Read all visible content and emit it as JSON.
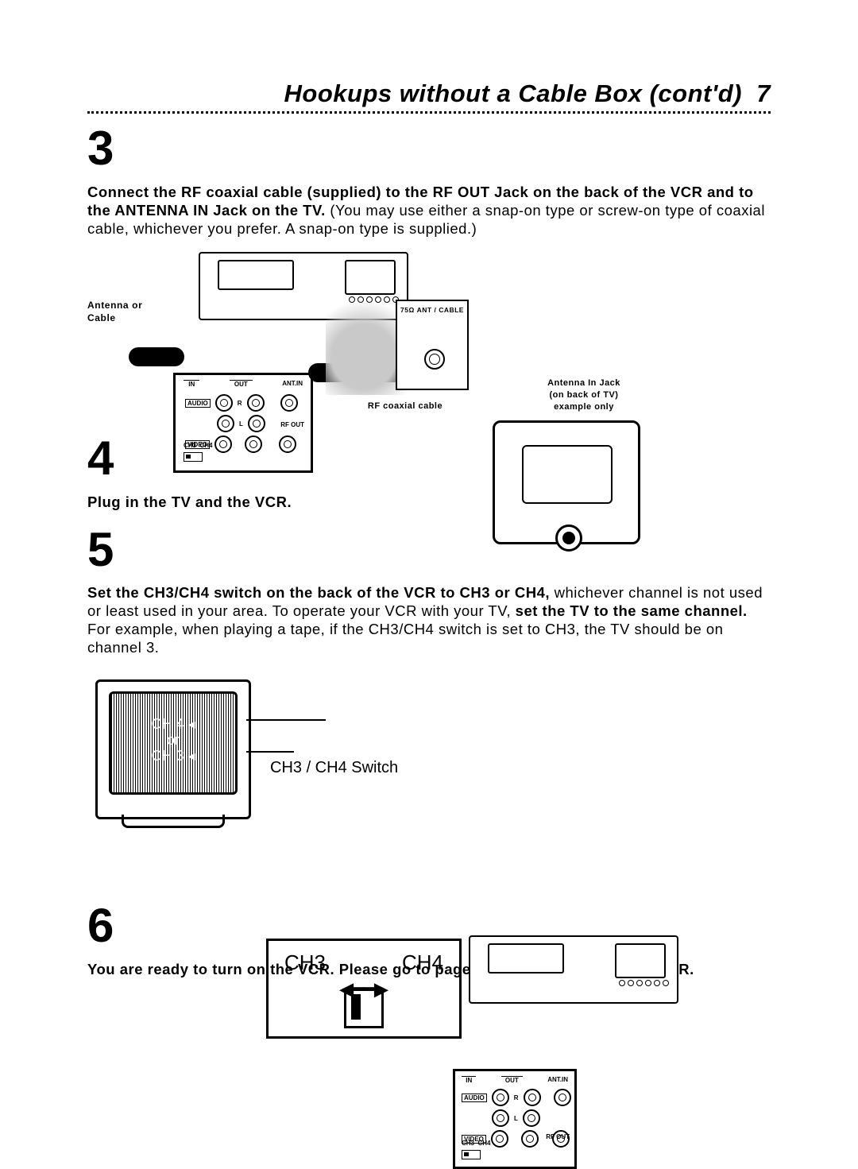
{
  "header": {
    "title": "Hookups without a Cable Box (cont'd)",
    "page": "7"
  },
  "step3": {
    "num": "3",
    "bold_a": "Connect the RF coaxial cable (supplied) to the RF OUT Jack on the back of the VCR and to the ANTENNA IN Jack on the TV.",
    "rest": " (You may use either a snap-on type or screw-on type of coaxial cable, whichever you prefer. A snap-on type is supplied.)"
  },
  "fig1": {
    "antenna_or_cable": "Antenna or Cable",
    "in": "IN",
    "out": "OUT",
    "ant_in": "ANT.IN",
    "audio": "AUDIO",
    "video": "VIDEO",
    "L": "L",
    "R": "R",
    "rf_out": "RF OUT",
    "ch3": "CH3",
    "ch4": "CH4",
    "port_label": "75Ω ANT / CABLE",
    "rf_cable": "RF coaxial cable",
    "ant_in_jack": "Antenna In Jack",
    "on_back": "(on back of TV)",
    "example": "example only"
  },
  "step4": {
    "num": "4",
    "bold": "Plug in the TV and the VCR."
  },
  "step5": {
    "num": "5",
    "bold_a": "Set the CH3/CH4 switch on the back of the VCR to CH3 or CH4,",
    "mid": " whichever channel is not used or least used in your area. To operate your VCR with your TV, ",
    "bold_b": "set the TV to the same channel.",
    "rest": " For example, when playing a tape, if the CH3/CH4 switch is set to CH3, the TV should be on channel 3."
  },
  "fig2": {
    "tv_ch4": "CH 4",
    "tv_or": "or",
    "tv_ch3": "CH 3",
    "switch_title": "CH3 / CH4 Switch",
    "CH3": "CH3",
    "CH4": "CH4",
    "in": "IN",
    "out": "OUT",
    "ant_in": "ANT.IN",
    "audio": "AUDIO",
    "video": "VIDEO",
    "L": "L",
    "R": "R",
    "rf_out": "RF OUT",
    "ch3s": "CH3",
    "ch4s": "CH4"
  },
  "step6": {
    "num": "6",
    "bold": "You are ready to turn on the VCR. Please go to page 10 before turning on the VCR."
  }
}
